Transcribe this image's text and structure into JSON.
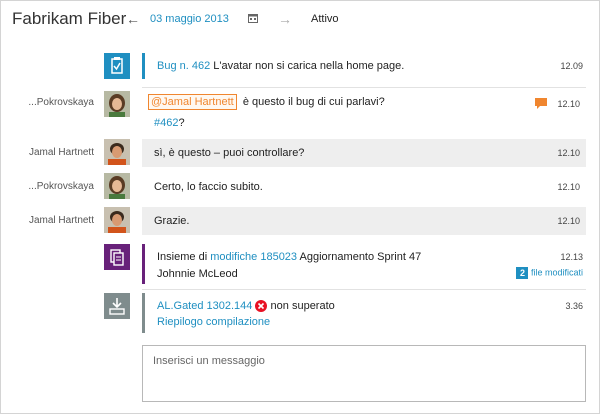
{
  "header": {
    "title": "Fabrikam Fiber",
    "date": "03 maggio 2013",
    "status": "Attivo"
  },
  "messages": [
    {
      "sender": "",
      "icon": "bug-tile-icon",
      "link": "Bug n. 462",
      "text": "L'avatar non si carica nella home page.",
      "time": "12.09"
    },
    {
      "sender": "...Pokrovskaya",
      "mention": "@Jamal Hartnett",
      "text": "è questo il bug di cui parlavi?",
      "link2": "#462",
      "text2": "?",
      "time": "12.10"
    },
    {
      "sender": "Jamal Hartnett",
      "text": "sì, è questo – puoi controllare?",
      "time": "12.10"
    },
    {
      "sender": "...Pokrovskaya",
      "text": "Certo, lo faccio subito.",
      "time": "12.10"
    },
    {
      "sender": "Jamal Hartnett",
      "text": "Grazie.",
      "time": "12.10"
    },
    {
      "sender": "",
      "icon": "changeset-tile-icon",
      "prefix": "Insieme di",
      "link": "modifiche 185023",
      "text": "Aggiornamento Sprint 47",
      "line2": "Johnnie McLeod",
      "badge": "2",
      "badge_label": "file modificati",
      "time": "12.13"
    },
    {
      "sender": "",
      "icon": "build-tile-icon",
      "link": "AL.Gated 1302.144",
      "text": "non superato",
      "link2": "Riepilogo compilazione",
      "time": "3.36"
    }
  ],
  "composer": {
    "placeholder": "Inserisci un messaggio"
  },
  "colors": {
    "accent": "#1f8fc1",
    "mention": "#f0862f",
    "changeset": "#68217a",
    "build": "#7f8c8d",
    "error": "#e81123"
  }
}
